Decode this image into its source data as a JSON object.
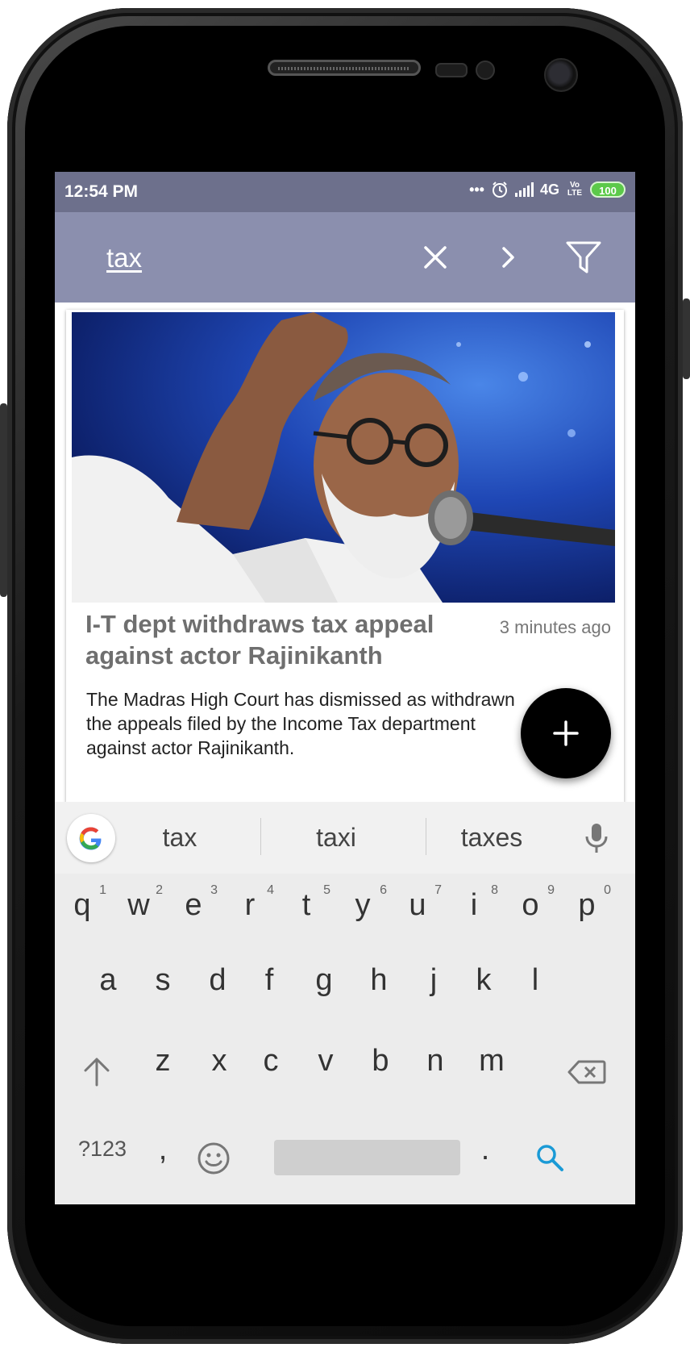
{
  "status_bar": {
    "time": "12:54 PM",
    "dots": "•••",
    "network": "4G",
    "volte": "Vo LTE",
    "battery": "100"
  },
  "app_bar": {
    "search_query": "tax",
    "clear_icon": "close-icon",
    "next_icon": "chevron-right-icon",
    "filter_icon": "filter-icon",
    "background": "#8b8fae"
  },
  "article": {
    "headline": "I-T dept withdraws tax appeal against actor Rajinikanth",
    "time_ago": "3 minutes ago",
    "summary": "The Madras High Court has dismissed as withdrawn the appeals filed by the Income Tax department against actor Rajinikanth."
  },
  "fab": {
    "label": "+"
  },
  "keyboard": {
    "suggestions": [
      "tax",
      "taxi",
      "taxes"
    ],
    "row1": [
      {
        "key": "q",
        "hint": "1"
      },
      {
        "key": "w",
        "hint": "2"
      },
      {
        "key": "e",
        "hint": "3"
      },
      {
        "key": "r",
        "hint": "4"
      },
      {
        "key": "t",
        "hint": "5"
      },
      {
        "key": "y",
        "hint": "6"
      },
      {
        "key": "u",
        "hint": "7"
      },
      {
        "key": "i",
        "hint": "8"
      },
      {
        "key": "o",
        "hint": "9"
      },
      {
        "key": "p",
        "hint": "0"
      }
    ],
    "row2": [
      "a",
      "s",
      "d",
      "f",
      "g",
      "h",
      "j",
      "k",
      "l"
    ],
    "row3": [
      "z",
      "x",
      "c",
      "v",
      "b",
      "n",
      "m"
    ],
    "symbols_label": "?123",
    "comma": ",",
    "period": ".",
    "accent": "#1a9ad6"
  }
}
